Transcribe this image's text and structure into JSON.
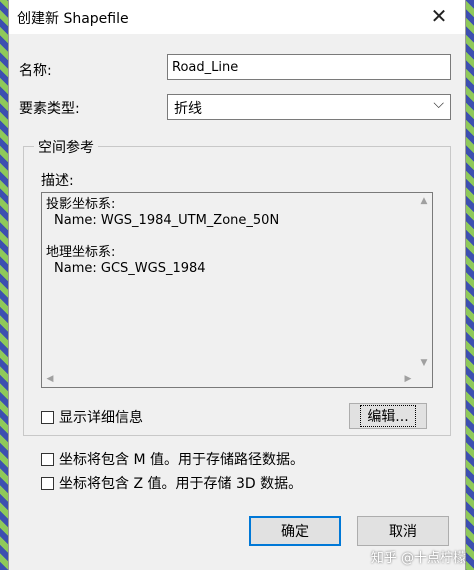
{
  "window": {
    "title": "创建新 Shapefile",
    "close_glyph": "✕"
  },
  "form": {
    "name_label": "名称:",
    "name_value": "Road_Line",
    "feature_type_label": "要素类型:",
    "feature_type_value": "折线"
  },
  "spatial_reference": {
    "group_title": "空间参考",
    "description_label": "描述:",
    "projected_heading": "投影坐标系:",
    "projected_name": "Name: WGS_1984_UTM_Zone_50N",
    "geographic_heading": "地理坐标系:",
    "geographic_name": "Name: GCS_WGS_1984",
    "show_details_label": "显示详细信息",
    "edit_button": "编辑..."
  },
  "options": {
    "m_values_label": "坐标将包含 M 值。用于存储路径数据。",
    "z_values_label": "坐标将包含 Z 值。用于存储 3D 数据。"
  },
  "buttons": {
    "ok": "确定",
    "cancel": "取消"
  },
  "watermark": "知乎 @十点柠檬"
}
